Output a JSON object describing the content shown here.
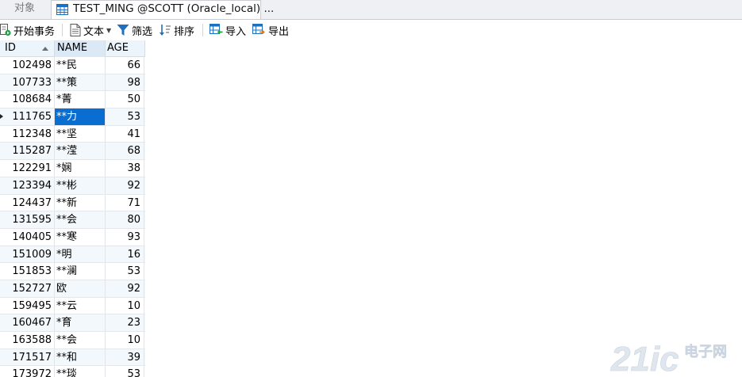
{
  "tabs": {
    "objects_label": "对象",
    "active_title": "TEST_MING @SCOTT (Oracle_local) ..."
  },
  "toolbar": {
    "begin_transaction": "开始事务",
    "text": "文本",
    "filter": "筛选",
    "sort": "排序",
    "import": "导入",
    "export": "导出"
  },
  "grid": {
    "columns": [
      "ID",
      "NAME",
      "AGE"
    ],
    "sorted_column": "NAME",
    "sort_direction": "ascending",
    "selected_row": 3,
    "selected_column": "NAME",
    "rows": [
      {
        "id": "102498",
        "name": "**民",
        "age": "66"
      },
      {
        "id": "107733",
        "name": "**策",
        "age": "98"
      },
      {
        "id": "108684",
        "name": "*菁",
        "age": "50"
      },
      {
        "id": "111765",
        "name": "**力",
        "age": "53"
      },
      {
        "id": "112348",
        "name": "**坚",
        "age": "41"
      },
      {
        "id": "115287",
        "name": "**滢",
        "age": "68"
      },
      {
        "id": "122291",
        "name": "*娴",
        "age": "38"
      },
      {
        "id": "123394",
        "name": "**彬",
        "age": "92"
      },
      {
        "id": "124437",
        "name": "**新",
        "age": "71"
      },
      {
        "id": "131595",
        "name": "**会",
        "age": "80"
      },
      {
        "id": "140405",
        "name": "**寒",
        "age": "93"
      },
      {
        "id": "151009",
        "name": "*明",
        "age": "16"
      },
      {
        "id": "151853",
        "name": "**澜",
        "age": "53"
      },
      {
        "id": "152727",
        "name": "欧",
        "age": "92"
      },
      {
        "id": "159495",
        "name": "**云",
        "age": "10"
      },
      {
        "id": "160467",
        "name": "*育",
        "age": "23"
      },
      {
        "id": "163588",
        "name": "**会",
        "age": "10"
      },
      {
        "id": "171517",
        "name": "**和",
        "age": "39"
      },
      {
        "id": "173972",
        "name": "**琰",
        "age": "53"
      }
    ]
  },
  "watermark": {
    "brand": "21ic",
    "subtitle": "电子网"
  },
  "colors": {
    "selection": "#0a6ed1",
    "header_bg": "#ecf4fc",
    "alt_row_bg": "#f3f8fd",
    "icon_blue": "#1d6fc0",
    "icon_green": "#2a9d4a"
  }
}
